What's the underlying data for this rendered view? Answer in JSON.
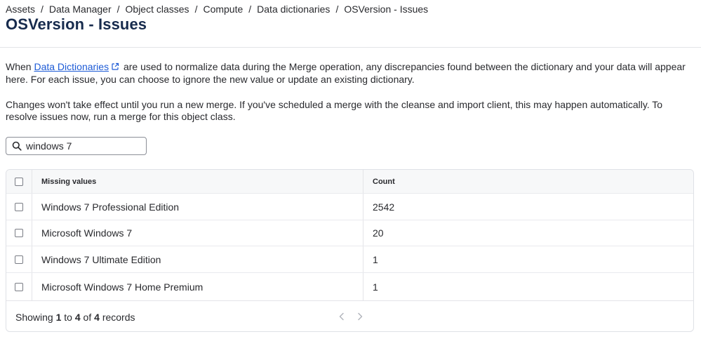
{
  "breadcrumb": [
    "Assets",
    "Data Manager",
    "Object classes",
    "Compute",
    "Data dictionaries",
    "OSVersion - Issues"
  ],
  "breadcrumb_separator": "/",
  "page_title": "OSVersion - Issues",
  "intro": {
    "lead": "When",
    "link_text": "Data Dictionaries",
    "rest": "are used to normalize data during the Merge operation, any discrepancies found between the dictionary and your data will appear here. For each issue, you can choose to ignore the new value or update an existing dictionary."
  },
  "note": "Changes won't take effect until you run a new merge. If you've scheduled a merge with the cleanse and import client, this may happen automatically. To resolve issues now, run a merge for this object class.",
  "search": {
    "value": "windows 7",
    "icon": "search-icon"
  },
  "table": {
    "columns": [
      "Missing values",
      "Count"
    ],
    "rows": [
      {
        "value": "Windows 7 Professional Edition",
        "count": "2542"
      },
      {
        "value": "Microsoft Windows 7",
        "count": "20"
      },
      {
        "value": "Windows 7 Ultimate Edition",
        "count": "1"
      },
      {
        "value": "Microsoft Windows 7 Home Premium",
        "count": "1"
      }
    ]
  },
  "pagination": {
    "showing": "Showing",
    "from": "1",
    "to_word": "to",
    "to": "4",
    "of_word": "of",
    "total": "4",
    "records": "records"
  },
  "colors": {
    "link": "#1d5bd6",
    "title": "#172b4d",
    "text": "#292a2e",
    "border": "#dfe1e6"
  }
}
